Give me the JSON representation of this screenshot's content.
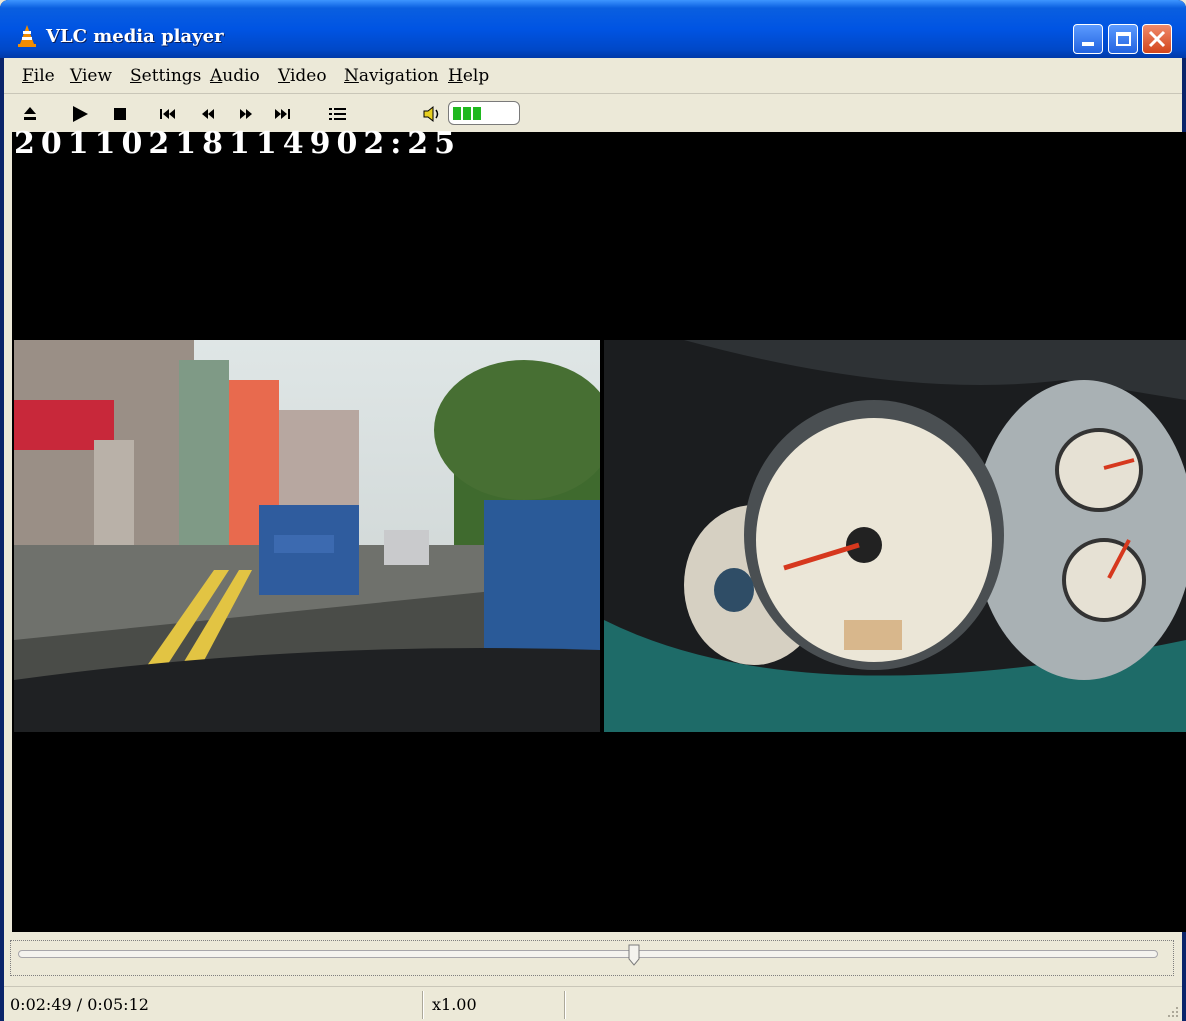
{
  "window": {
    "title": "VLC media player"
  },
  "menu": [
    {
      "first": "F",
      "rest": "ile"
    },
    {
      "first": "V",
      "rest": "iew"
    },
    {
      "first": "S",
      "rest": "ettings"
    },
    {
      "first": "A",
      "rest": "udio"
    },
    {
      "first": "V",
      "rest": "ideo"
    },
    {
      "first": "N",
      "rest": "avigation"
    },
    {
      "first": "H",
      "rest": "elp"
    }
  ],
  "toolbar": {
    "icons": [
      "eject-icon",
      "play-icon",
      "stop-icon",
      "previous-icon",
      "rewind-icon",
      "fast-forward-icon",
      "next-icon",
      "playlist-icon",
      "speaker-icon"
    ],
    "volume_fraction": 0.45,
    "volume_color": "#1fb81f"
  },
  "video": {
    "timestamp": "20110218114902:25",
    "overlay_color": "#ffffff"
  },
  "seek": {
    "position_fraction": 0.54
  },
  "status": {
    "time": "0:02:49 / 0:05:12",
    "speed": "x1.00"
  }
}
